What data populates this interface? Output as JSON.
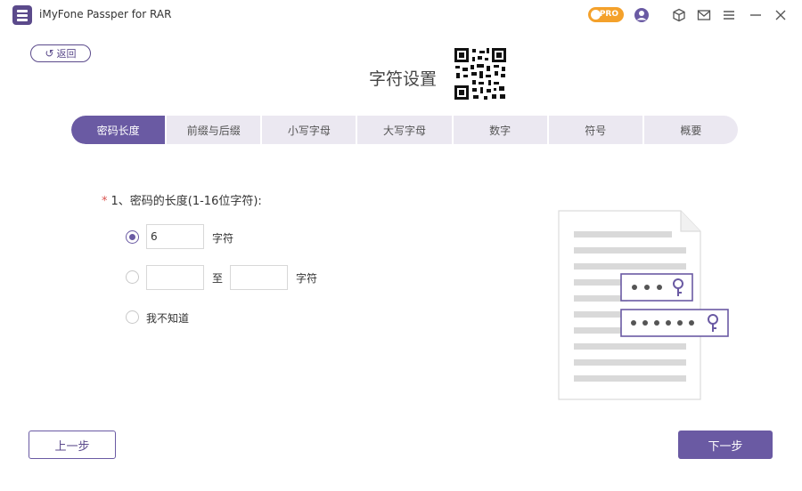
{
  "app": {
    "title": "iMyFone Passper for RAR",
    "pro_label": "PRO"
  },
  "icons": {
    "app_logo": "app-logo-icon",
    "pro": "crown-icon",
    "account": "user-icon",
    "product": "cube-icon",
    "mail": "mail-icon",
    "menu": "menu-icon",
    "minimize": "minimize-icon",
    "close": "close-icon"
  },
  "colors": {
    "accent": "#6a5aa3",
    "tab_bg": "#ebe8f1",
    "pro_badge": "#f4a12b",
    "required": "#d9534f"
  },
  "header": {
    "back_label": "返回",
    "page_title": "字符设置"
  },
  "tabs": [
    {
      "label": "密码长度",
      "active": true
    },
    {
      "label": "前缀与后缀",
      "active": false
    },
    {
      "label": "小写字母",
      "active": false
    },
    {
      "label": "大写字母",
      "active": false
    },
    {
      "label": "数字",
      "active": false
    },
    {
      "label": "符号",
      "active": false
    },
    {
      "label": "概要",
      "active": false
    }
  ],
  "form": {
    "required_mark": "*",
    "question": "1、密码的长度(1-16位字符):",
    "options": [
      {
        "value": "6",
        "unit": "字符",
        "checked": true
      },
      {
        "from": "",
        "to_label": "至",
        "to": "",
        "unit": "字符",
        "checked": false
      },
      {
        "label": "我不知道",
        "checked": false
      }
    ]
  },
  "footer": {
    "prev_label": "上一步",
    "next_label": "下一步"
  }
}
